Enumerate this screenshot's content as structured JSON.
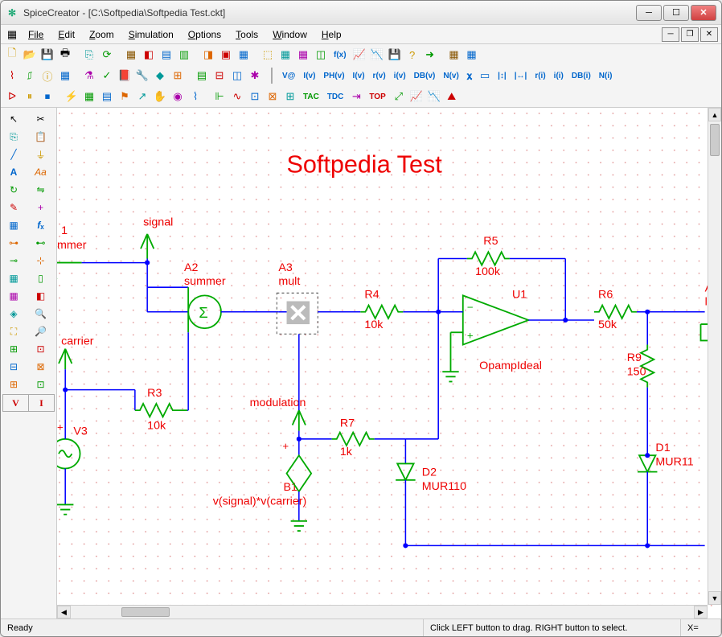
{
  "window": {
    "app_name": "SpiceCreator",
    "document_path": "[C:\\Softpedia\\Softpedia Test.ckt]"
  },
  "menu": {
    "file": "File",
    "edit": "Edit",
    "zoom": "Zoom",
    "simulation": "Simulation",
    "options": "Options",
    "tools": "Tools",
    "window": "Window",
    "help": "Help"
  },
  "circuit": {
    "title": "Softpedia Test",
    "labels": {
      "signal": "signal",
      "carrier": "carrier",
      "modulation": "modulation",
      "a1_name": "1",
      "a1_type": "mmer",
      "a2_name": "A2",
      "a2_type": "summer",
      "a3_name": "A3",
      "a3_type": "mult",
      "a_name": "A",
      "a_type": "lim",
      "r3_name": "R3",
      "r3_value": "10k",
      "r4_name": "R4",
      "r4_value": "10k",
      "r5_name": "R5",
      "r5_value": "100k",
      "r6_name": "R6",
      "r6_value": "50k",
      "r7_name": "R7",
      "r7_value": "1k",
      "r9_name": "R9",
      "r9_value": "150",
      "u1_name": "U1",
      "u1_type": "OpampIdeal",
      "b1_name": "B1",
      "b1_expr": "v(signal)*v(carrier)",
      "v3_name": "V3",
      "d1_name": "D1",
      "d1_type": "MUR11",
      "d2_name": "D2",
      "d2_type": "MUR110"
    }
  },
  "status": {
    "ready": "Ready",
    "hint": "Click LEFT button to drag. RIGHT button to select.",
    "coord_label": "X="
  },
  "toolbox_labels": {
    "v": "V",
    "i": "I"
  },
  "meas_labels": {
    "vat": "V@",
    "iv": "I(v)",
    "ph": "PH(v)",
    "iv2": "I(v)",
    "rv": "r(v)",
    "iv3": "i(v)",
    "db": "DB(v)",
    "nv": "N(v)",
    "x": "𝛘",
    "h": "▭",
    "bars": "|↕|",
    "bars2": "|↔|",
    "ri": "r(i)",
    "ii": "i(i)",
    "dbi": "DB(i)",
    "ni": "N(i)"
  },
  "colors": {
    "wire": "#0000ff",
    "component": "#00a000",
    "label": "#e00000"
  }
}
